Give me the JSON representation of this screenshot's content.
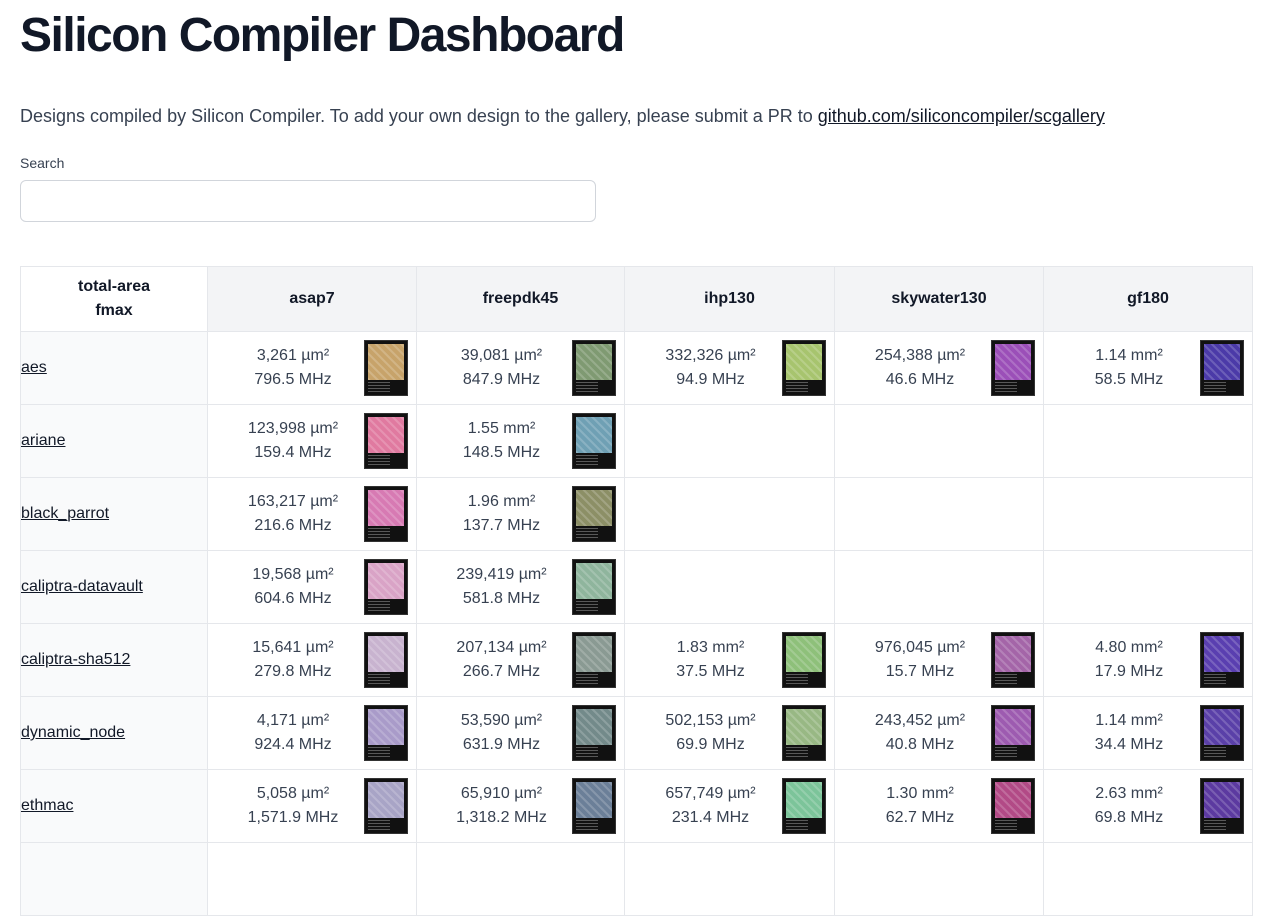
{
  "header": {
    "title": "Silicon Compiler Dashboard",
    "intro_text": "Designs compiled by Silicon Compiler. To add your own design to the gallery, please submit a PR to ",
    "intro_link": "github.com/siliconcompiler/scgallery"
  },
  "search": {
    "label": "Search",
    "value": "",
    "placeholder": ""
  },
  "table": {
    "corner_line1": "total-area",
    "corner_line2": "fmax",
    "pdks": [
      "asap7",
      "freepdk45",
      "ihp130",
      "skywater130",
      "gf180"
    ],
    "rows": [
      {
        "design": "aes",
        "cells": [
          {
            "area": "3,261 µm²",
            "fmax": "796.5 MHz",
            "thumb": "#c7a36a"
          },
          {
            "area": "39,081 µm²",
            "fmax": "847.9 MHz",
            "thumb": "#7f9a72"
          },
          {
            "area": "332,326 µm²",
            "fmax": "94.9 MHz",
            "thumb": "#a7c46e"
          },
          {
            "area": "254,388 µm²",
            "fmax": "46.6 MHz",
            "thumb": "#9b4fb8"
          },
          {
            "area": "1.14 mm²",
            "fmax": "58.5 MHz",
            "thumb": "#4b3aa8"
          }
        ]
      },
      {
        "design": "ariane",
        "cells": [
          {
            "area": "123,998 µm²",
            "fmax": "159.4 MHz",
            "thumb": "#e07aa0"
          },
          {
            "area": "1.55 mm²",
            "fmax": "148.5 MHz",
            "thumb": "#6fa0b4"
          },
          null,
          null,
          null
        ]
      },
      {
        "design": "black_parrot",
        "cells": [
          {
            "area": "163,217 µm²",
            "fmax": "216.6 MHz",
            "thumb": "#d77ab3"
          },
          {
            "area": "1.96 mm²",
            "fmax": "137.7 MHz",
            "thumb": "#8c8f66"
          },
          null,
          null,
          null
        ]
      },
      {
        "design": "caliptra-datavault",
        "cells": [
          {
            "area": "19,568 µm²",
            "fmax": "604.6 MHz",
            "thumb": "#d9a3c6"
          },
          {
            "area": "239,419 µm²",
            "fmax": "581.8 MHz",
            "thumb": "#8fb59d"
          },
          null,
          null,
          null
        ]
      },
      {
        "design": "caliptra-sha512",
        "cells": [
          {
            "area": "15,641 µm²",
            "fmax": "279.8 MHz",
            "thumb": "#c8b3cf"
          },
          {
            "area": "207,134 µm²",
            "fmax": "266.7 MHz",
            "thumb": "#8a9a93"
          },
          {
            "area": "1.83 mm²",
            "fmax": "37.5 MHz",
            "thumb": "#8ec07a"
          },
          {
            "area": "976,045 µm²",
            "fmax": "15.7 MHz",
            "thumb": "#a465a8"
          },
          {
            "area": "4.80 mm²",
            "fmax": "17.9 MHz",
            "thumb": "#5a3fb0"
          }
        ]
      },
      {
        "design": "dynamic_node",
        "cells": [
          {
            "area": "4,171 µm²",
            "fmax": "924.4 MHz",
            "thumb": "#a99bc9"
          },
          {
            "area": "53,590 µm²",
            "fmax": "631.9 MHz",
            "thumb": "#738a8a"
          },
          {
            "area": "502,153 µm²",
            "fmax": "69.9 MHz",
            "thumb": "#98b884"
          },
          {
            "area": "243,452 µm²",
            "fmax": "40.8 MHz",
            "thumb": "#9d5bb0"
          },
          {
            "area": "1.14 mm²",
            "fmax": "34.4 MHz",
            "thumb": "#5a40a8"
          }
        ]
      },
      {
        "design": "ethmac",
        "cells": [
          {
            "area": "5,058 µm²",
            "fmax": "1,571.9 MHz",
            "thumb": "#a8a4c6"
          },
          {
            "area": "65,910 µm²",
            "fmax": "1,318.2 MHz",
            "thumb": "#6b7f98"
          },
          {
            "area": "657,749 µm²",
            "fmax": "231.4 MHz",
            "thumb": "#7cc49a"
          },
          {
            "area": "1.30 mm²",
            "fmax": "62.7 MHz",
            "thumb": "#b24a86"
          },
          {
            "area": "2.63 mm²",
            "fmax": "69.8 MHz",
            "thumb": "#5c3aa0"
          }
        ]
      },
      {
        "design": "",
        "cells": [
          null,
          null,
          null,
          null,
          null
        ]
      }
    ]
  }
}
